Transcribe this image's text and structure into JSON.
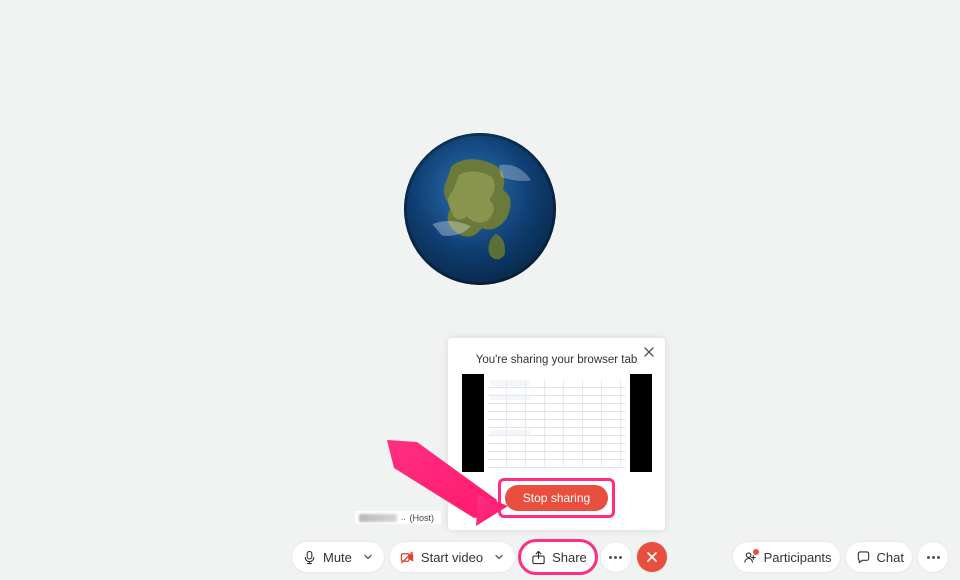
{
  "avatar": {
    "semantic": "earth-avatar"
  },
  "host_label": {
    "role": "(Host)"
  },
  "sharing_popover": {
    "title": "You're sharing your browser tab",
    "stop_label": "Stop sharing"
  },
  "controls": {
    "mute": {
      "label": "Mute"
    },
    "video": {
      "label": "Start video"
    },
    "share": {
      "label": "Share"
    },
    "participants": {
      "label": "Participants"
    },
    "chat": {
      "label": "Chat"
    }
  }
}
